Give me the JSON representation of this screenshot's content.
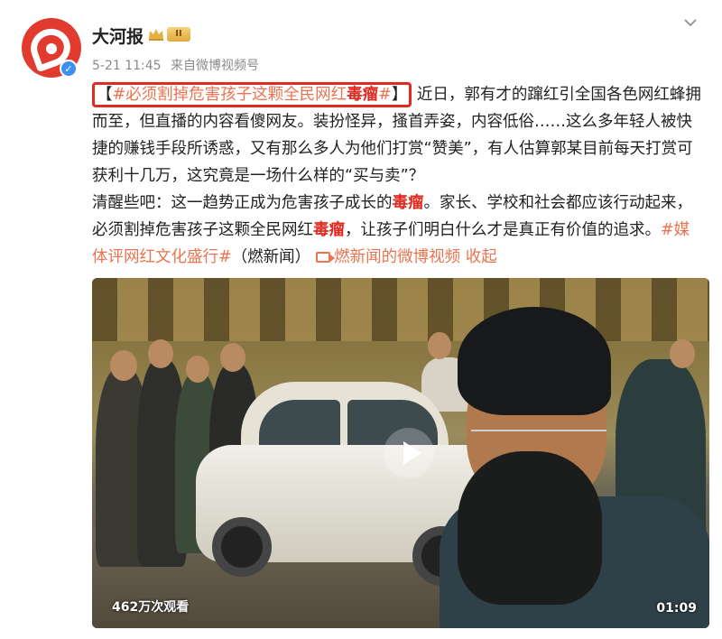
{
  "account": {
    "name": "大河报",
    "vip_badge": "II",
    "time": "5-21 11:45",
    "source_prefix": "来自",
    "source": "微博视频号"
  },
  "post": {
    "hashtag1": "#必须割掉危害孩子这颗全民网红",
    "tox1": "毒瘤",
    "hashtag1_end": "#",
    "bracket_open": "【",
    "bracket_close": "】",
    "p1": "近日，郭有才的蹿红引全国各色网红蜂拥而至，但直播的内容看傻网友。装扮怪异，搔首弄姿，内容低俗……这么多年轻人被快捷的赚钱手段所诱惑，又有那么多人为他们打赏“赞美”，有人估算郭某目前每天打赏可获利十几万，这究竟是一场什么样的“买与卖”？",
    "p2a": "清醒些吧：这一趋势正成为危害孩子成长的",
    "tox2": "毒瘤",
    "p2b": "。家长、学校和社会都应该行动起来，必须割掉危害孩子这颗全民网红",
    "tox3": "毒瘤",
    "p2c": "，让孩子们明白什么才是真正有价值的追求。",
    "hashtag2": "#媒体评网红文化盛行#",
    "source_note": "（燃新闻）",
    "video_link": "燃新闻的微博视频",
    "collapse": "收起"
  },
  "video": {
    "views": "462万次观看",
    "duration": "01:09"
  },
  "colors": {
    "link": "#eb7350",
    "highlight_box": "#e02b22",
    "verify": "#3d8ff0"
  },
  "icons": [
    "avatar-logo-icon",
    "verified-icon",
    "crown-icon",
    "more-chevron-icon",
    "video-link-icon",
    "play-icon"
  ]
}
